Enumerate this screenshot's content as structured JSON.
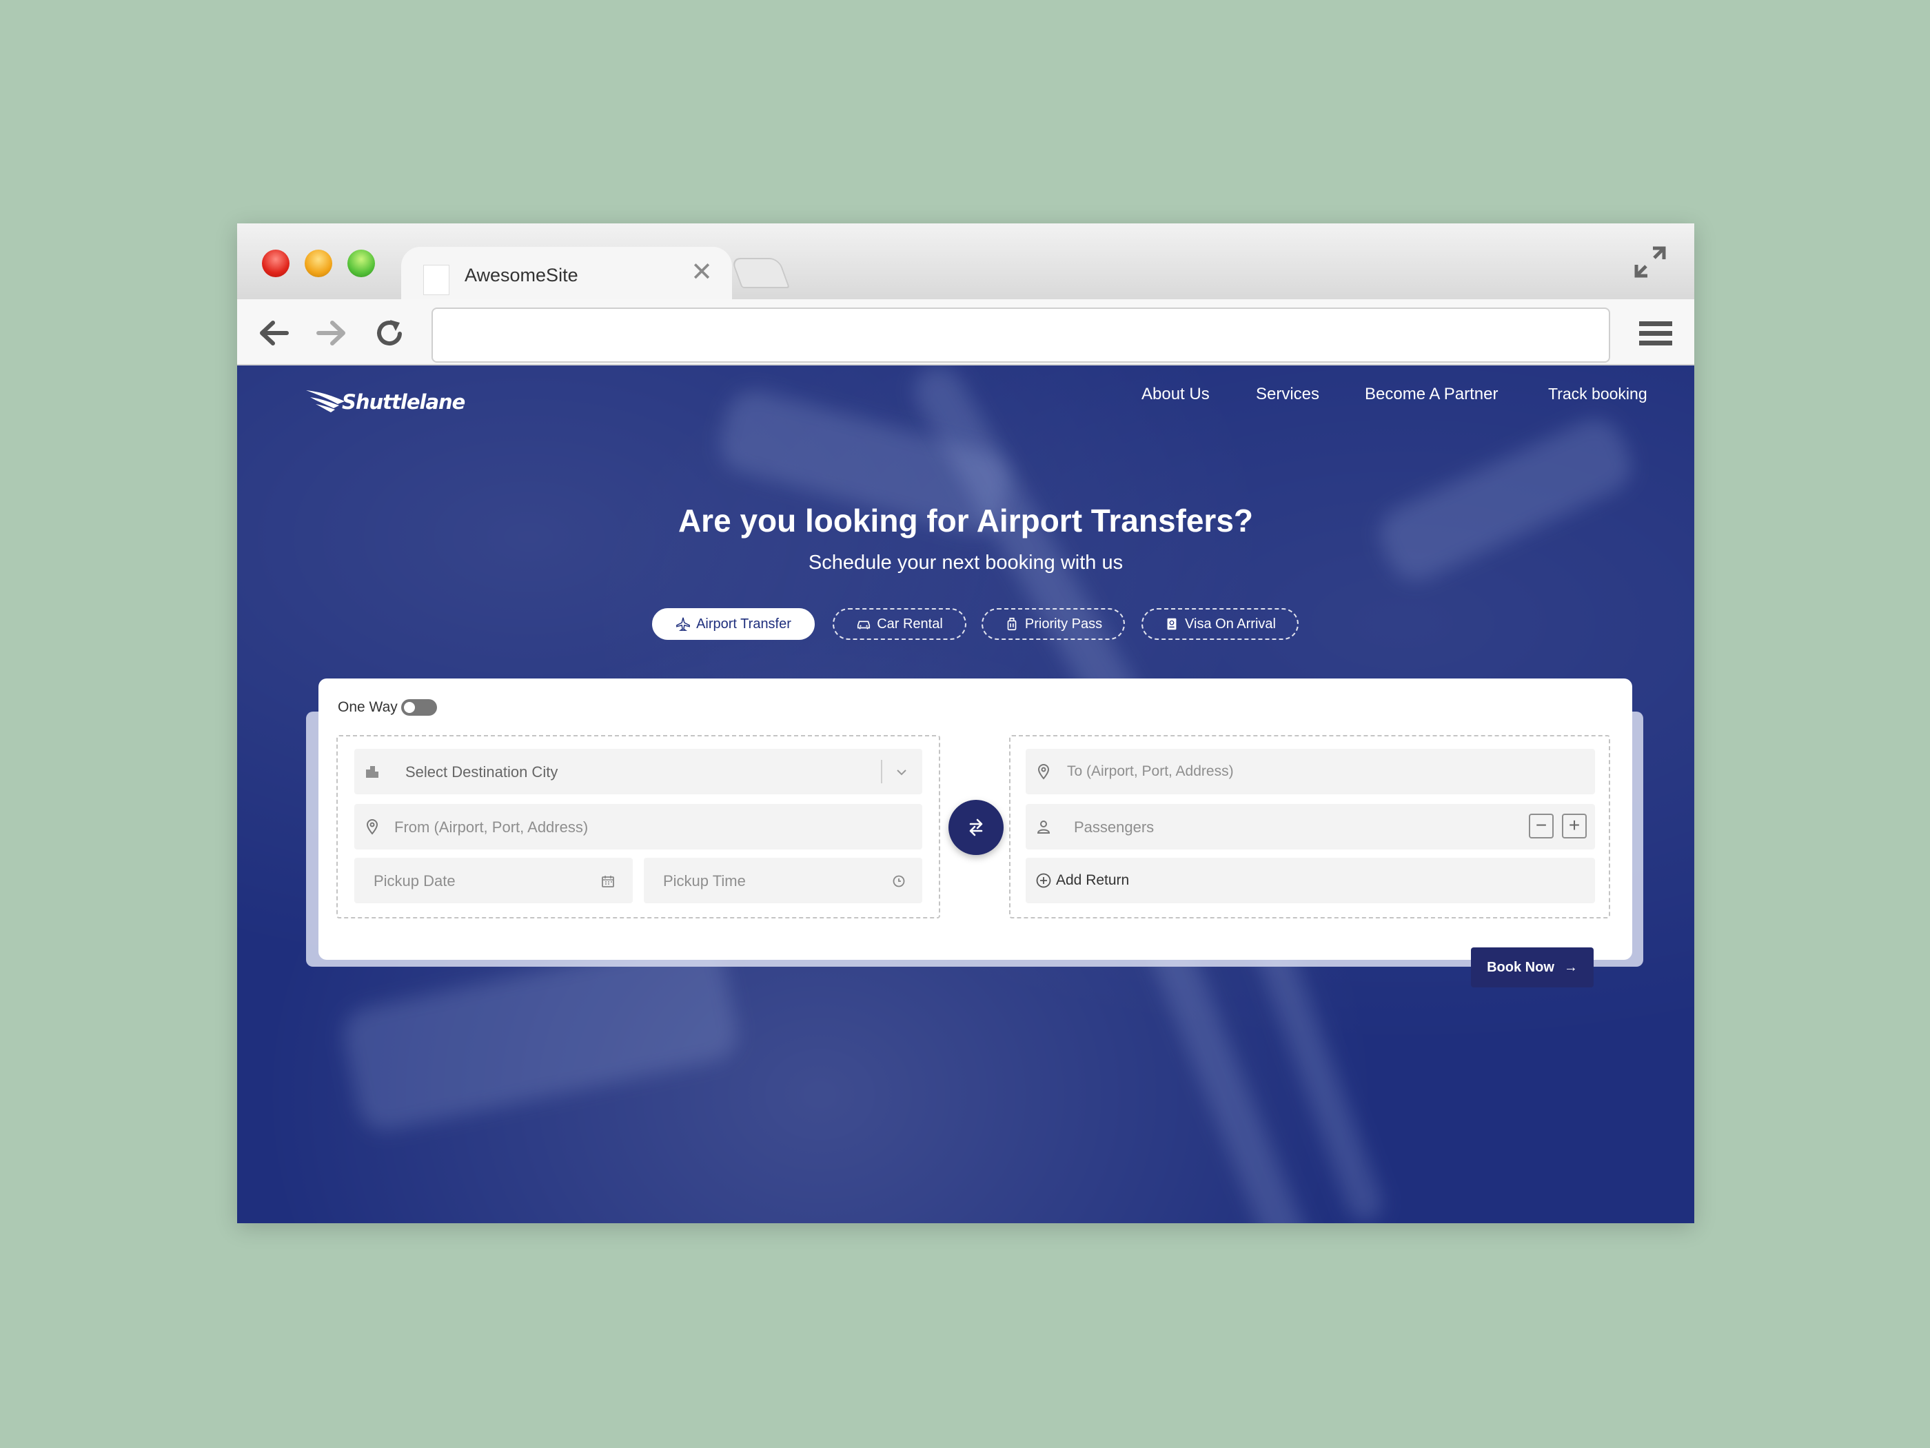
{
  "browser": {
    "tab_title": "AwesomeSite",
    "tab_close": "✕",
    "url": ""
  },
  "site": {
    "logo_text": "Shuttlelane",
    "nav": [
      "About Us",
      "Services",
      "Become A Partner",
      "Track booking"
    ]
  },
  "hero": {
    "title": "Are you looking for Airport Transfers?",
    "subtitle": "Schedule your next booking with us"
  },
  "service_tabs": [
    {
      "label": "Airport Transfer",
      "icon": "plane-icon",
      "active": true
    },
    {
      "label": "Car Rental",
      "icon": "car-icon",
      "active": false
    },
    {
      "label": "Priority Pass",
      "icon": "luggage-icon",
      "active": false
    },
    {
      "label": "Visa On Arrival",
      "icon": "passport-icon",
      "active": false
    }
  ],
  "booking": {
    "trip_toggle_label": "One Way",
    "destination_city_placeholder": "Select Destination City",
    "from_placeholder": "From (Airport, Port, Address)",
    "pickup_date_placeholder": "Pickup Date",
    "pickup_time_placeholder": "Pickup Time",
    "to_placeholder": "To (Airport, Port, Address)",
    "passengers_placeholder": "Passengers",
    "decrement_label": "−",
    "increment_label": "+",
    "add_return_label": "Add Return",
    "book_now_label": "Book Now",
    "book_now_arrow": "→"
  },
  "colors": {
    "page_background": "#adc9b3",
    "hero_blue": "#1f2f7d",
    "accent_navy": "#232a6c"
  }
}
